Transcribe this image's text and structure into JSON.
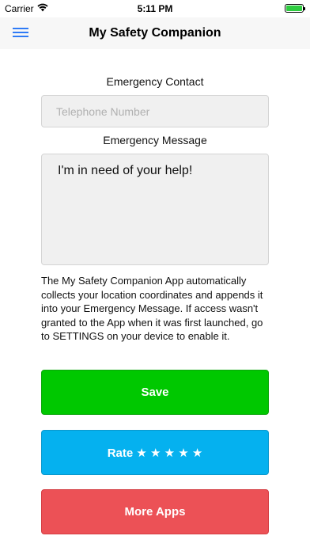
{
  "status_bar": {
    "carrier": "Carrier",
    "time": "5:11 PM",
    "wifi_icon": "wifi-icon",
    "battery_icon": "battery-icon"
  },
  "nav": {
    "title": "My Safety Companion",
    "menu_icon": "hamburger-menu-icon"
  },
  "form": {
    "contact_label": "Emergency Contact",
    "phone_placeholder": "Telephone Number",
    "phone_value": "",
    "message_label": "Emergency Message",
    "message_value": "I'm in need of your help!"
  },
  "info": {
    "text": "The My Safety Companion App automatically collects your location coordinates and appends it into your Emergency Message. If access wasn't granted to the App when it was first launched, go to SETTINGS on your device to enable it."
  },
  "buttons": {
    "save_label": "Save",
    "rate_label": "Rate ★ ★ ★ ★ ★",
    "more_label": "More Apps"
  },
  "colors": {
    "accent_blue": "#2f7bf6",
    "save_green": "#00c800",
    "rate_blue": "#05b1ef",
    "more_red": "#ec5156"
  }
}
